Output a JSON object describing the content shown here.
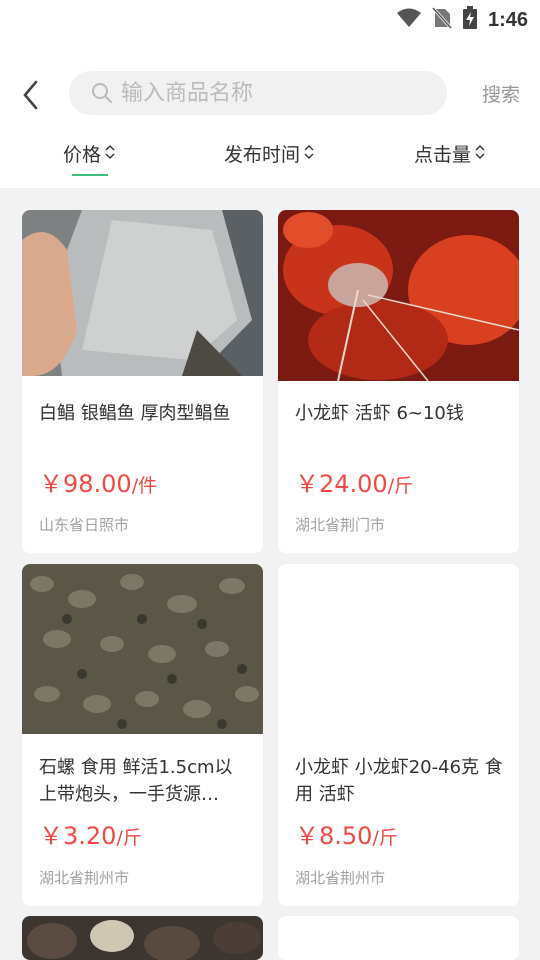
{
  "status": {
    "time": "1:46"
  },
  "header": {
    "search_placeholder": "输入商品名称",
    "search_label": "搜索"
  },
  "sort_tabs": [
    {
      "label": "价格"
    },
    {
      "label": "发布时间"
    },
    {
      "label": "点击量"
    }
  ],
  "colors": {
    "accent": "#3cbf7e",
    "price": "#f04a43"
  },
  "products": [
    {
      "title": "白鲳 银鲳鱼 厚肉型鲳鱼",
      "price": "￥98.00",
      "unit": "/件",
      "location": "山东省日照市"
    },
    {
      "title": "小龙虾 活虾 6~10钱",
      "price": "￥24.00",
      "unit": "/斤",
      "location": "湖北省荆门市"
    },
    {
      "title": "石螺 食用 鲜活1.5cm以上带炮头，一手货源…",
      "price": "￥3.20",
      "unit": "/斤",
      "location": "湖北省荆州市"
    },
    {
      "title": "小龙虾 小龙虾20-46克 食用 活虾",
      "price": "￥8.50",
      "unit": "/斤",
      "location": "湖北省荆州市"
    }
  ]
}
